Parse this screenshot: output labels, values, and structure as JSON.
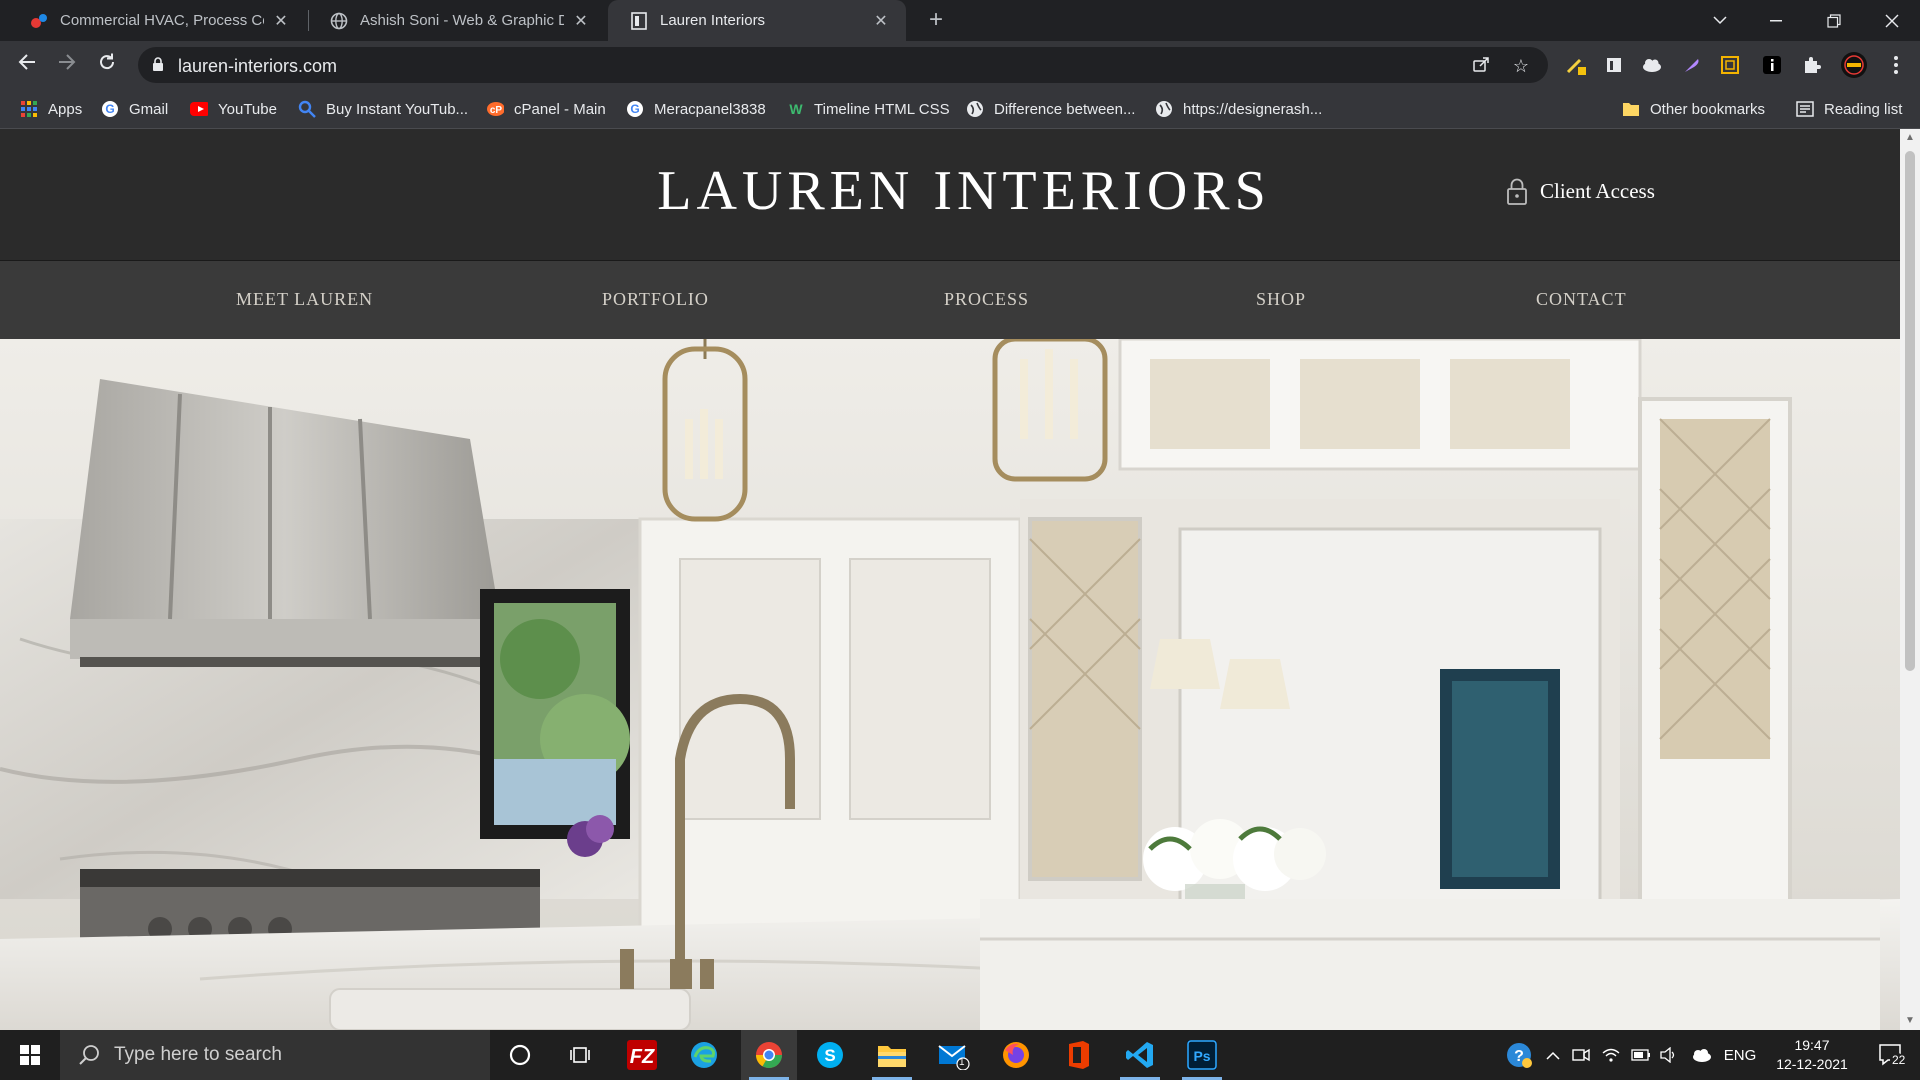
{
  "browser": {
    "tabs": [
      {
        "title": "Commercial HVAC, Process Cooli",
        "icon": "hvac-favicon-icon"
      },
      {
        "title": "Ashish Soni - Web & Graphic De",
        "icon": "globe-favicon-icon"
      },
      {
        "title": "Lauren Interiors",
        "icon": "page-favicon-icon",
        "active": true
      }
    ],
    "url": "lauren-interiors.com",
    "bookmarks": [
      {
        "label": "Apps"
      },
      {
        "label": "Gmail"
      },
      {
        "label": "YouTube"
      },
      {
        "label": "Buy Instant YouTub..."
      },
      {
        "label": "cPanel - Main"
      },
      {
        "label": "Meracpanel3838"
      },
      {
        "label": "Timeline HTML CSS"
      },
      {
        "label": "Difference between..."
      },
      {
        "label": "https://designerash..."
      }
    ],
    "other_bookmarks": "Other bookmarks",
    "reading_list": "Reading list"
  },
  "site": {
    "brand": "LAUREN INTERIORS",
    "client_access": "Client Access",
    "nav": [
      "MEET LAUREN",
      "PORTFOLIO",
      "PROCESS",
      "SHOP",
      "CONTACT"
    ]
  },
  "taskbar": {
    "search_placeholder": "Type here to search",
    "language": "ENG",
    "time": "19:47",
    "date": "12-12-2021",
    "notification_count": "22",
    "mail_badge": "1"
  },
  "colors": {
    "chrome_dark": "#202124",
    "chrome_toolbar": "#35363a",
    "site_header": "#2b2b2b",
    "site_nav": "#3a3a3a",
    "nav_text": "#d4d0c8"
  }
}
